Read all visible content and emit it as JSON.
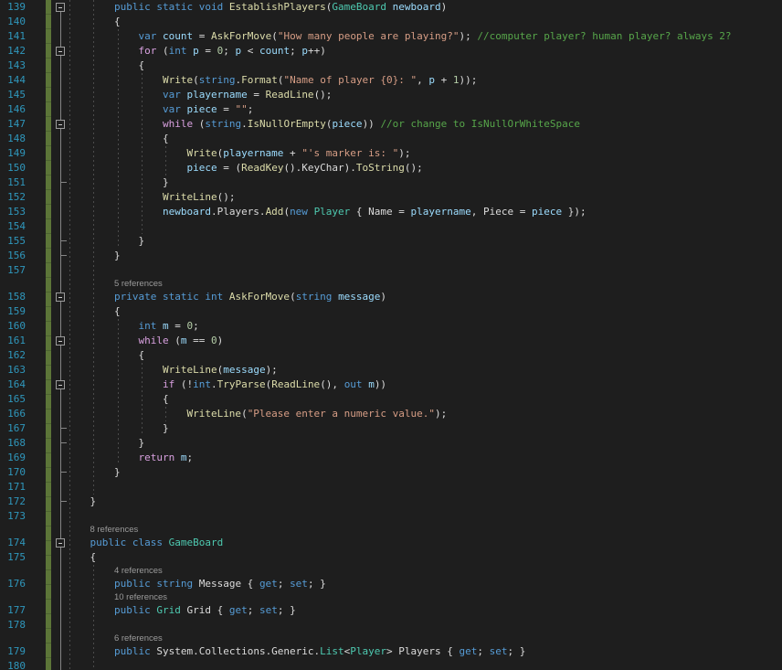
{
  "editor": {
    "language": "csharp",
    "colors": {
      "background": "#1e1e1e",
      "plain": "#dcdcdc",
      "keyword": "#569cd6",
      "control_keyword": "#d8a0df",
      "method": "#dcdcaa",
      "type": "#4ec9b0",
      "variable": "#9cdcfe",
      "string": "#d69d85",
      "comment": "#57a64a",
      "number": "#b5cea8",
      "line_number": "#2f97bc",
      "codelens": "#9b9b9b",
      "change_bar": "#5c7538",
      "indent_guide": "#4b4b4b",
      "outline": "#858585"
    },
    "first_line": 139,
    "last_line": 180,
    "rows": [
      {
        "line": 139,
        "fold": true,
        "tokens": [
          [
            "p",
            "        "
          ],
          [
            "kw",
            "public static void "
          ],
          [
            "m",
            "EstablishPlayers"
          ],
          [
            "p",
            "("
          ],
          [
            "ty",
            "GameBoard"
          ],
          [
            "p",
            " "
          ],
          [
            "v",
            "newboard"
          ],
          [
            "p",
            ")"
          ]
        ]
      },
      {
        "line": 140,
        "tokens": [
          [
            "p",
            "        {"
          ]
        ]
      },
      {
        "line": 141,
        "tokens": [
          [
            "p",
            "            "
          ],
          [
            "kw",
            "var"
          ],
          [
            "p",
            " "
          ],
          [
            "v",
            "count"
          ],
          [
            "p",
            " = "
          ],
          [
            "m",
            "AskForMove"
          ],
          [
            "p",
            "("
          ],
          [
            "s",
            "\"How many people are playing?\""
          ],
          [
            "p",
            "); "
          ],
          [
            "c",
            "//computer player? human player? always 2?"
          ]
        ]
      },
      {
        "line": 142,
        "fold": true,
        "tokens": [
          [
            "p",
            "            "
          ],
          [
            "ctl",
            "for"
          ],
          [
            "p",
            " ("
          ],
          [
            "kw",
            "int"
          ],
          [
            "p",
            " "
          ],
          [
            "v",
            "p"
          ],
          [
            "p",
            " = "
          ],
          [
            "n",
            "0"
          ],
          [
            "p",
            "; "
          ],
          [
            "v",
            "p"
          ],
          [
            "p",
            " < "
          ],
          [
            "v",
            "count"
          ],
          [
            "p",
            "; "
          ],
          [
            "v",
            "p"
          ],
          [
            "p",
            "++)"
          ]
        ]
      },
      {
        "line": 143,
        "tokens": [
          [
            "p",
            "            {"
          ]
        ]
      },
      {
        "line": 144,
        "tokens": [
          [
            "p",
            "                "
          ],
          [
            "m",
            "Write"
          ],
          [
            "p",
            "("
          ],
          [
            "kw",
            "string"
          ],
          [
            "p",
            "."
          ],
          [
            "m",
            "Format"
          ],
          [
            "p",
            "("
          ],
          [
            "s",
            "\"Name of player {0}: \""
          ],
          [
            "p",
            ", "
          ],
          [
            "v",
            "p"
          ],
          [
            "p",
            " + "
          ],
          [
            "n",
            "1"
          ],
          [
            "p",
            "));"
          ]
        ]
      },
      {
        "line": 145,
        "tokens": [
          [
            "p",
            "                "
          ],
          [
            "kw",
            "var"
          ],
          [
            "p",
            " "
          ],
          [
            "v",
            "playername"
          ],
          [
            "p",
            " = "
          ],
          [
            "m",
            "ReadLine"
          ],
          [
            "p",
            "();"
          ]
        ]
      },
      {
        "line": 146,
        "tokens": [
          [
            "p",
            "                "
          ],
          [
            "kw",
            "var"
          ],
          [
            "p",
            " "
          ],
          [
            "v",
            "piece"
          ],
          [
            "p",
            " = "
          ],
          [
            "s",
            "\"\""
          ],
          [
            "p",
            ";"
          ]
        ]
      },
      {
        "line": 147,
        "fold": true,
        "tokens": [
          [
            "p",
            "                "
          ],
          [
            "ctl",
            "while"
          ],
          [
            "p",
            " ("
          ],
          [
            "kw",
            "string"
          ],
          [
            "p",
            "."
          ],
          [
            "m",
            "IsNullOrEmpty"
          ],
          [
            "p",
            "("
          ],
          [
            "v",
            "piece"
          ],
          [
            "p",
            ")) "
          ],
          [
            "c",
            "//or change to IsNullOrWhiteSpace"
          ]
        ]
      },
      {
        "line": 148,
        "tokens": [
          [
            "p",
            "                {"
          ]
        ]
      },
      {
        "line": 149,
        "tokens": [
          [
            "p",
            "                    "
          ],
          [
            "m",
            "Write"
          ],
          [
            "p",
            "("
          ],
          [
            "v",
            "playername"
          ],
          [
            "p",
            " + "
          ],
          [
            "s",
            "\"'s marker is: \""
          ],
          [
            "p",
            ");"
          ]
        ]
      },
      {
        "line": 150,
        "tokens": [
          [
            "p",
            "                    "
          ],
          [
            "v",
            "piece"
          ],
          [
            "p",
            " = ("
          ],
          [
            "m",
            "ReadKey"
          ],
          [
            "p",
            "().KeyChar)."
          ],
          [
            "m",
            "ToString"
          ],
          [
            "p",
            "();"
          ]
        ]
      },
      {
        "line": 151,
        "tick": true,
        "tokens": [
          [
            "p",
            "                }"
          ]
        ]
      },
      {
        "line": 152,
        "tokens": [
          [
            "p",
            "                "
          ],
          [
            "m",
            "WriteLine"
          ],
          [
            "p",
            "();"
          ]
        ]
      },
      {
        "line": 153,
        "tokens": [
          [
            "p",
            "                "
          ],
          [
            "v",
            "newboard"
          ],
          [
            "p",
            ".Players."
          ],
          [
            "m",
            "Add"
          ],
          [
            "p",
            "("
          ],
          [
            "kw",
            "new"
          ],
          [
            "p",
            " "
          ],
          [
            "ty",
            "Player"
          ],
          [
            "p",
            " { Name = "
          ],
          [
            "v",
            "playername"
          ],
          [
            "p",
            ", Piece = "
          ],
          [
            "v",
            "piece"
          ],
          [
            "p",
            " });"
          ]
        ]
      },
      {
        "line": 154,
        "tokens": []
      },
      {
        "line": 155,
        "tick": true,
        "tokens": [
          [
            "p",
            "            }"
          ]
        ]
      },
      {
        "line": 156,
        "tick": true,
        "tokens": [
          [
            "p",
            "        }"
          ]
        ]
      },
      {
        "line": 157,
        "tokens": []
      },
      {
        "lens": "5 references",
        "indent_cols": 8
      },
      {
        "line": 158,
        "fold": true,
        "tokens": [
          [
            "p",
            "        "
          ],
          [
            "kw",
            "private static int "
          ],
          [
            "m",
            "AskForMove"
          ],
          [
            "p",
            "("
          ],
          [
            "kw",
            "string"
          ],
          [
            "p",
            " "
          ],
          [
            "v",
            "message"
          ],
          [
            "p",
            ")"
          ]
        ]
      },
      {
        "line": 159,
        "tokens": [
          [
            "p",
            "        {"
          ]
        ]
      },
      {
        "line": 160,
        "tokens": [
          [
            "p",
            "            "
          ],
          [
            "kw",
            "int"
          ],
          [
            "p",
            " "
          ],
          [
            "v",
            "m"
          ],
          [
            "p",
            " = "
          ],
          [
            "n",
            "0"
          ],
          [
            "p",
            ";"
          ]
        ]
      },
      {
        "line": 161,
        "fold": true,
        "tokens": [
          [
            "p",
            "            "
          ],
          [
            "ctl",
            "while"
          ],
          [
            "p",
            " ("
          ],
          [
            "v",
            "m"
          ],
          [
            "p",
            " == "
          ],
          [
            "n",
            "0"
          ],
          [
            "p",
            ")"
          ]
        ]
      },
      {
        "line": 162,
        "tokens": [
          [
            "p",
            "            {"
          ]
        ]
      },
      {
        "line": 163,
        "tokens": [
          [
            "p",
            "                "
          ],
          [
            "m",
            "WriteLine"
          ],
          [
            "p",
            "("
          ],
          [
            "v",
            "message"
          ],
          [
            "p",
            ");"
          ]
        ]
      },
      {
        "line": 164,
        "fold": true,
        "tokens": [
          [
            "p",
            "                "
          ],
          [
            "ctl",
            "if"
          ],
          [
            "p",
            " (!"
          ],
          [
            "kw",
            "int"
          ],
          [
            "p",
            "."
          ],
          [
            "m",
            "TryParse"
          ],
          [
            "p",
            "("
          ],
          [
            "m",
            "ReadLine"
          ],
          [
            "p",
            "(), "
          ],
          [
            "kw",
            "out"
          ],
          [
            "p",
            " "
          ],
          [
            "v",
            "m"
          ],
          [
            "p",
            "))"
          ]
        ]
      },
      {
        "line": 165,
        "tokens": [
          [
            "p",
            "                {"
          ]
        ]
      },
      {
        "line": 166,
        "tokens": [
          [
            "p",
            "                    "
          ],
          [
            "m",
            "WriteLine"
          ],
          [
            "p",
            "("
          ],
          [
            "s",
            "\"Please enter a numeric value.\""
          ],
          [
            "p",
            ");"
          ]
        ]
      },
      {
        "line": 167,
        "tick": true,
        "tokens": [
          [
            "p",
            "                }"
          ]
        ]
      },
      {
        "line": 168,
        "tick": true,
        "tokens": [
          [
            "p",
            "            }"
          ]
        ]
      },
      {
        "line": 169,
        "tokens": [
          [
            "p",
            "            "
          ],
          [
            "ctl",
            "return"
          ],
          [
            "p",
            " "
          ],
          [
            "v",
            "m"
          ],
          [
            "p",
            ";"
          ]
        ]
      },
      {
        "line": 170,
        "tick": true,
        "tokens": [
          [
            "p",
            "        }"
          ]
        ]
      },
      {
        "line": 171,
        "tokens": []
      },
      {
        "line": 172,
        "tick": true,
        "tokens": [
          [
            "p",
            "    }"
          ]
        ]
      },
      {
        "line": 173,
        "tokens": []
      },
      {
        "lens": "8 references",
        "indent_cols": 4
      },
      {
        "line": 174,
        "fold": true,
        "tokens": [
          [
            "p",
            "    "
          ],
          [
            "kw",
            "public class "
          ],
          [
            "ty",
            "GameBoard"
          ]
        ]
      },
      {
        "line": 175,
        "tokens": [
          [
            "p",
            "    {"
          ]
        ]
      },
      {
        "lens": "4 references",
        "indent_cols": 8
      },
      {
        "line": 176,
        "tokens": [
          [
            "p",
            "        "
          ],
          [
            "kw",
            "public string "
          ],
          [
            "p",
            "Message { "
          ],
          [
            "kw",
            "get"
          ],
          [
            "p",
            "; "
          ],
          [
            "kw",
            "set"
          ],
          [
            "p",
            "; }"
          ]
        ]
      },
      {
        "lens": "10 references",
        "indent_cols": 8
      },
      {
        "line": 177,
        "tokens": [
          [
            "p",
            "        "
          ],
          [
            "kw",
            "public"
          ],
          [
            "p",
            " "
          ],
          [
            "ty",
            "Grid"
          ],
          [
            "p",
            " Grid { "
          ],
          [
            "kw",
            "get"
          ],
          [
            "p",
            "; "
          ],
          [
            "kw",
            "set"
          ],
          [
            "p",
            "; }"
          ]
        ]
      },
      {
        "line": 178,
        "tokens": []
      },
      {
        "lens": "6 references",
        "indent_cols": 8
      },
      {
        "line": 179,
        "tokens": [
          [
            "p",
            "        "
          ],
          [
            "kw",
            "public"
          ],
          [
            "p",
            " System.Collections.Generic."
          ],
          [
            "ty",
            "List"
          ],
          [
            "p",
            "<"
          ],
          [
            "ty",
            "Player"
          ],
          [
            "p",
            "> Players { "
          ],
          [
            "kw",
            "get"
          ],
          [
            "p",
            "; "
          ],
          [
            "kw",
            "set"
          ],
          [
            "p",
            "; }"
          ]
        ]
      },
      {
        "line": 180,
        "tokens": []
      }
    ]
  }
}
